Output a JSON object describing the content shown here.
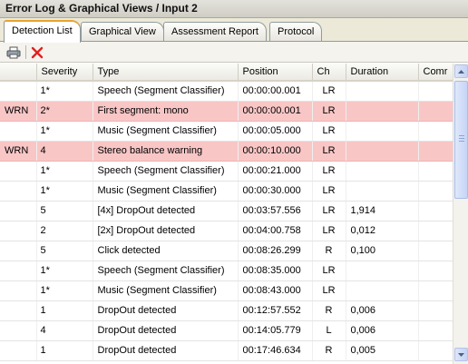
{
  "window": {
    "title": "Error Log & Graphical Views / Input 2"
  },
  "tabs": [
    {
      "label": "Detection List",
      "active": true
    },
    {
      "label": "Graphical View",
      "active": false
    },
    {
      "label": "Assessment Report",
      "active": false
    },
    {
      "label": "Protocol",
      "active": false
    }
  ],
  "toolbar": {
    "print_icon": "printer-icon",
    "delete_icon": "delete-x-icon"
  },
  "colors": {
    "warning_row": "#f9c6c6",
    "delete_red": "#e02020",
    "active_tab_accent": "#e7a32e"
  },
  "table": {
    "columns": [
      "",
      "Severity",
      "Type",
      "Position",
      "Ch",
      "Duration",
      "Comr"
    ],
    "rows": [
      {
        "flag": "",
        "severity": "1*",
        "type": "Speech (Segment Classifier)",
        "position": "00:00:00.001",
        "ch": "LR",
        "duration": "",
        "warn": false
      },
      {
        "flag": "WRN",
        "severity": "2*",
        "type": "First segment: mono",
        "position": "00:00:00.001",
        "ch": "LR",
        "duration": "",
        "warn": true
      },
      {
        "flag": "",
        "severity": "1*",
        "type": "Music (Segment Classifier)",
        "position": "00:00:05.000",
        "ch": "LR",
        "duration": "",
        "warn": false
      },
      {
        "flag": "WRN",
        "severity": "4",
        "type": "Stereo balance warning",
        "position": "00:00:10.000",
        "ch": "LR",
        "duration": "",
        "warn": true
      },
      {
        "flag": "",
        "severity": "1*",
        "type": "Speech (Segment Classifier)",
        "position": "00:00:21.000",
        "ch": "LR",
        "duration": "",
        "warn": false
      },
      {
        "flag": "",
        "severity": "1*",
        "type": "Music (Segment Classifier)",
        "position": "00:00:30.000",
        "ch": "LR",
        "duration": "",
        "warn": false
      },
      {
        "flag": "",
        "severity": "5",
        "type": "[4x] DropOut detected",
        "position": "00:03:57.556",
        "ch": "LR",
        "duration": "1,914",
        "warn": false
      },
      {
        "flag": "",
        "severity": "2",
        "type": "[2x] DropOut detected",
        "position": "00:04:00.758",
        "ch": "LR",
        "duration": "0,012",
        "warn": false
      },
      {
        "flag": "",
        "severity": "5",
        "type": "Click detected",
        "position": "00:08:26.299",
        "ch": "R",
        "duration": "0,100",
        "warn": false
      },
      {
        "flag": "",
        "severity": "1*",
        "type": "Speech (Segment Classifier)",
        "position": "00:08:35.000",
        "ch": "LR",
        "duration": "",
        "warn": false
      },
      {
        "flag": "",
        "severity": "1*",
        "type": "Music (Segment Classifier)",
        "position": "00:08:43.000",
        "ch": "LR",
        "duration": "",
        "warn": false
      },
      {
        "flag": "",
        "severity": "1",
        "type": "DropOut detected",
        "position": "00:12:57.552",
        "ch": "R",
        "duration": "0,006",
        "warn": false
      },
      {
        "flag": "",
        "severity": "4",
        "type": "DropOut detected",
        "position": "00:14:05.779",
        "ch": "L",
        "duration": "0,006",
        "warn": false
      },
      {
        "flag": "",
        "severity": "1",
        "type": "DropOut detected",
        "position": "00:17:46.634",
        "ch": "R",
        "duration": "0,005",
        "warn": false
      }
    ]
  }
}
